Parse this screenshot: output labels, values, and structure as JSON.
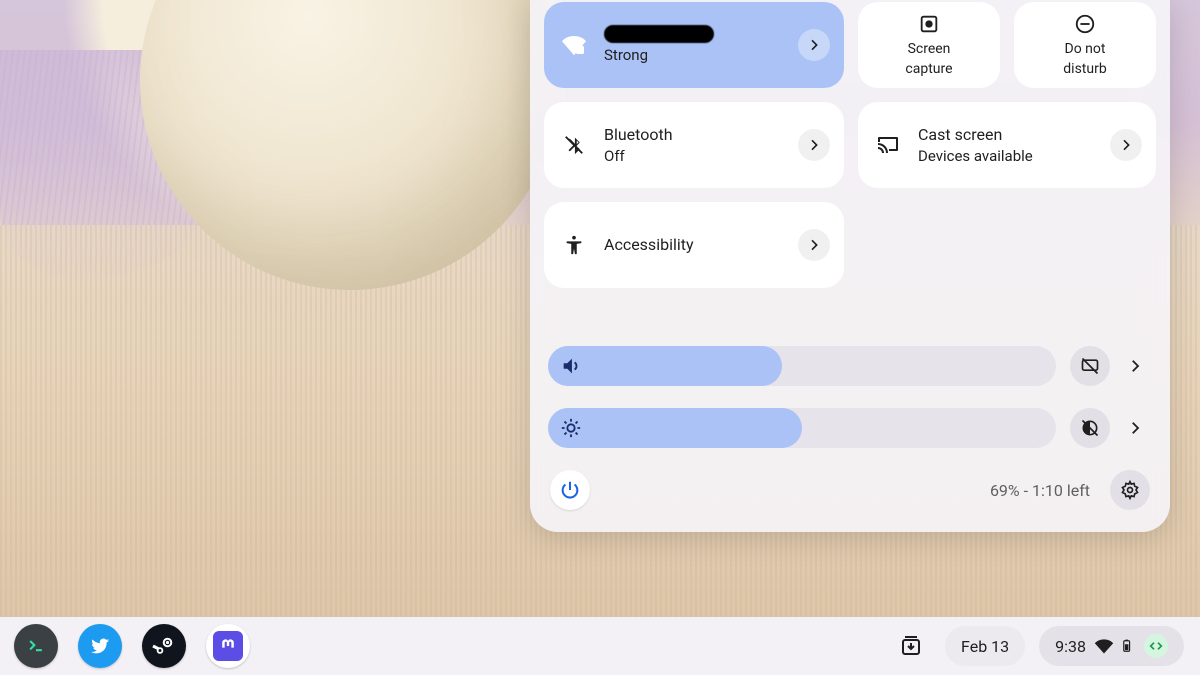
{
  "quick_settings": {
    "wifi": {
      "signal": "Strong"
    },
    "screen_capture": {
      "label1": "Screen",
      "label2": "capture"
    },
    "dnd": {
      "label1": "Do not",
      "label2": "disturb"
    },
    "bluetooth": {
      "label": "Bluetooth",
      "state": "Off"
    },
    "cast": {
      "label": "Cast screen",
      "sub": "Devices available"
    },
    "accessibility": {
      "label": "Accessibility"
    },
    "sliders": {
      "volume_percent": 46,
      "brightness_percent": 50
    },
    "footer": {
      "battery_text": "69% - 1:10 left"
    }
  },
  "shelf": {
    "date": "Feb 13",
    "time": "9:38"
  }
}
